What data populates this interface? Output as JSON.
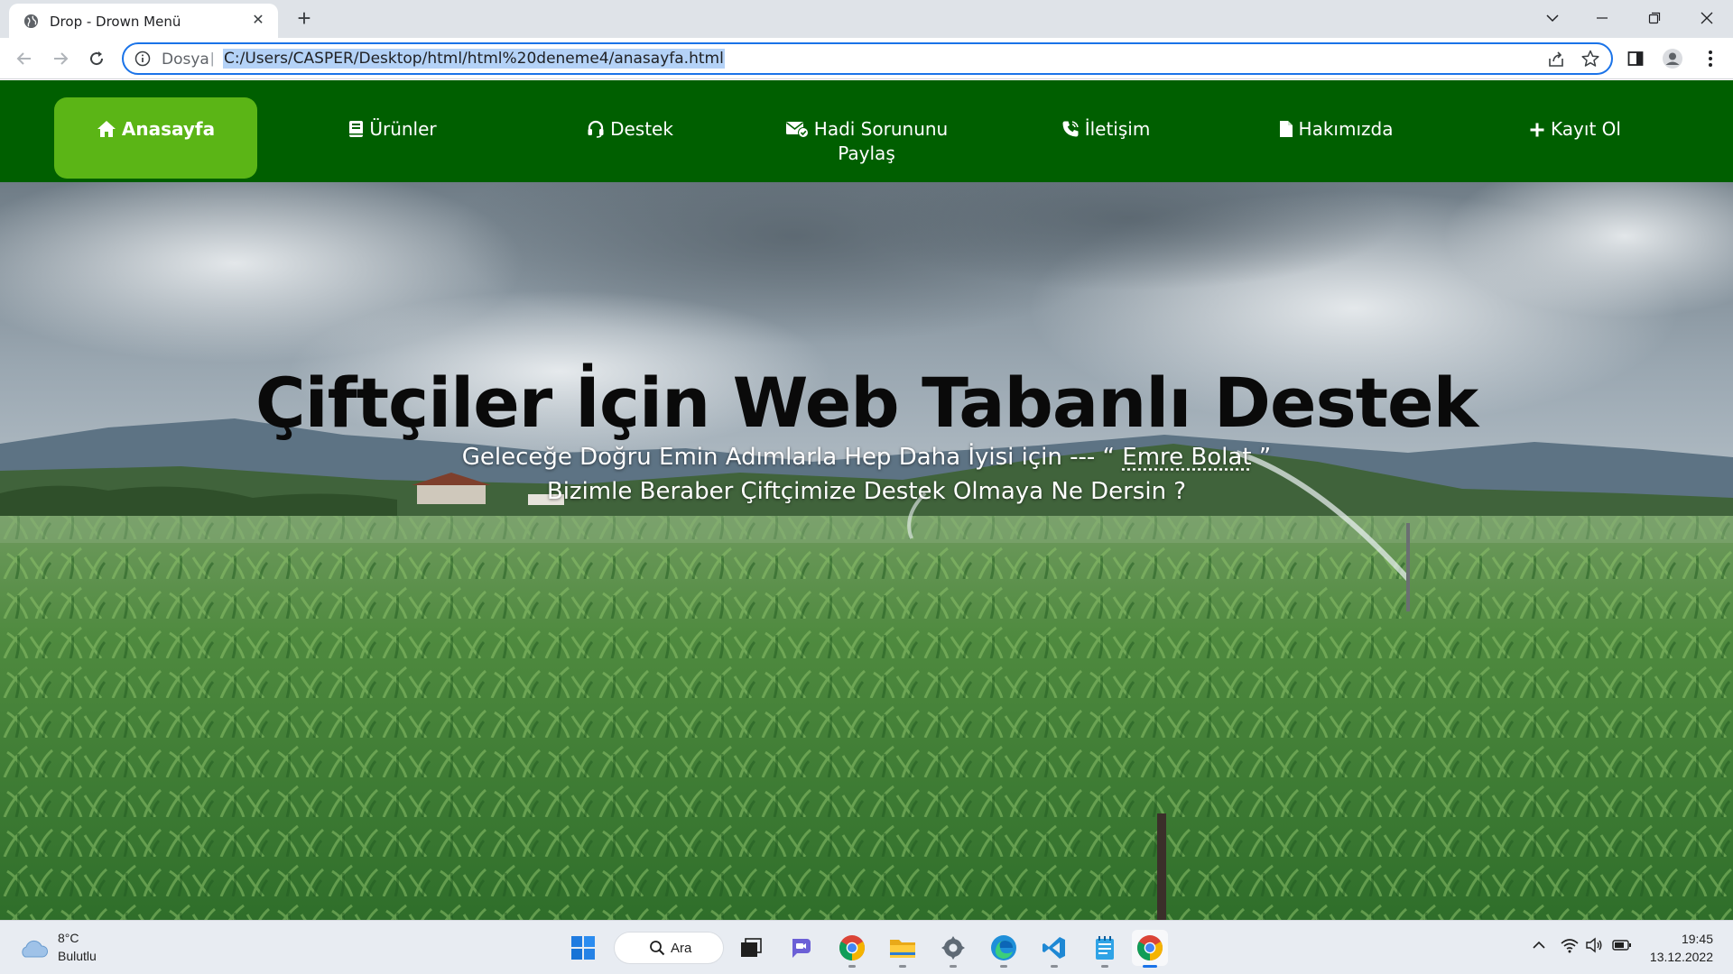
{
  "browser": {
    "tab_title": "Drop - Drown Menü",
    "address_scheme": "Dosya",
    "address_url": "C:/Users/CASPER/Desktop/html/html%20deneme4/anasayfa.html"
  },
  "site": {
    "nav": [
      {
        "label": "Anasayfa",
        "icon": "home-icon",
        "active": true
      },
      {
        "label": "Ürünler",
        "icon": "book-icon",
        "active": false
      },
      {
        "label": "Destek",
        "icon": "headset-icon",
        "active": false
      },
      {
        "label": "Hadi Sorununu Paylaş",
        "icon": "envelope-check-icon",
        "active": false
      },
      {
        "label": "İletişim",
        "icon": "phone-icon",
        "active": false
      },
      {
        "label": "Hakımızda",
        "icon": "document-icon",
        "active": false
      },
      {
        "label": "Kayıt Ol",
        "icon": "plus-icon",
        "active": false
      }
    ],
    "nav_colors": {
      "bar": "#005f00",
      "active": "#5bb516"
    },
    "hero": {
      "title": "Çiftçiler İçin Web Tabanlı Destek",
      "subtitle_prefix": "Geleceğe Doğru Emin Adımlarla Hep Daha İyisi için --- “",
      "author": "Emre Bolat",
      "subtitle_suffix": "”",
      "subtitle_line2": "Bizimle Beraber Çiftçimize Destek Olmaya Ne Dersin ?"
    }
  },
  "taskbar": {
    "weather_temp": "8°C",
    "weather_condition": "Bulutlu",
    "search_label": "Ara",
    "time": "19:45",
    "date": "13.12.2022"
  }
}
